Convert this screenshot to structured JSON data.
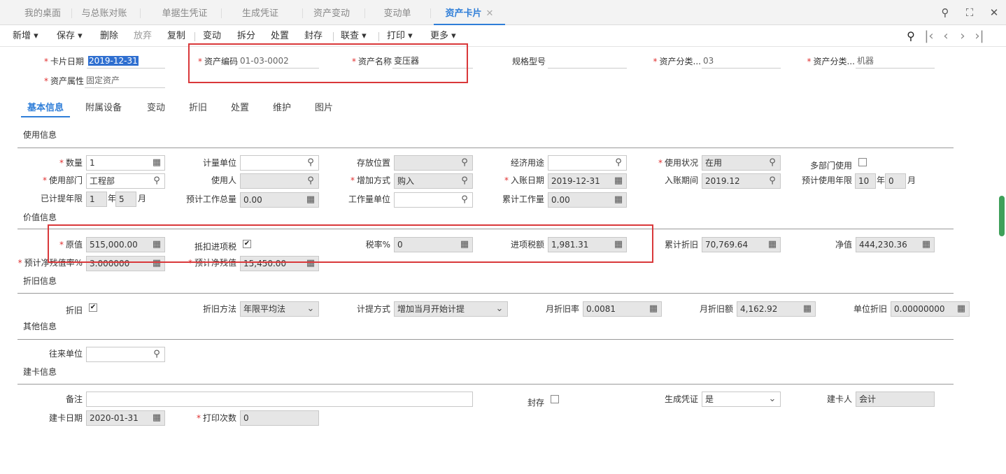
{
  "tabs": [
    "我的桌面",
    "与总账对账",
    "单据生凭证",
    "生成凭证",
    "资产变动",
    "变动单",
    "资产卡片"
  ],
  "tab_close": "✕",
  "toolbar": {
    "new": "新增",
    "save": "保存",
    "delete": "删除",
    "discard": "放弃",
    "copy": "复制",
    "change": "变动",
    "split": "拆分",
    "dispose": "处置",
    "seal": "封存",
    "link": "联查",
    "print": "打印",
    "more": "更多"
  },
  "header": {
    "card_date_label": "卡片日期",
    "card_date": "2019-12-31",
    "asset_code_label": "资产编码",
    "asset_code": "01-03-0002",
    "asset_name_label": "资产名称",
    "asset_name": "变压器",
    "spec_label": "规格型号",
    "spec": "",
    "category1_label": "资产分类...",
    "category1": "03",
    "category2_label": "资产分类...",
    "category2": "机器",
    "attr_label": "资产属性",
    "attr": "固定资产"
  },
  "subtabs": [
    "基本信息",
    "附属设备",
    "变动",
    "折旧",
    "处置",
    "维护",
    "图片"
  ],
  "sections": {
    "usage": "使用信息",
    "value": "价值信息",
    "depr": "折旧信息",
    "other": "其他信息",
    "create": "建卡信息"
  },
  "usage": {
    "qty_label": "数量",
    "qty": "1",
    "unit_label": "计量单位",
    "unit": "",
    "location_label": "存放位置",
    "location": "",
    "econ_label": "经济用途",
    "econ": "",
    "status_label": "使用状况",
    "status": "在用",
    "multi_dept_label": "多部门使用",
    "dept_label": "使用部门",
    "dept": "工程部",
    "user_label": "使用人",
    "user": "",
    "add_method_label": "增加方式",
    "add_method": "购入",
    "entry_date_label": "入账日期",
    "entry_date": "2019-12-31",
    "entry_period_label": "入账期间",
    "entry_period": "2019.12",
    "life_label": "预计使用年限",
    "life_years": "10",
    "life_months": "0",
    "year_unit": "年",
    "month_unit": "月",
    "accrued_label": "已计提年限",
    "accrued_years": "1",
    "accrued_months": "5",
    "total_work_label": "预计工作总量",
    "total_work": "0.00",
    "work_unit_label": "工作量单位",
    "work_unit": "",
    "accum_work_label": "累计工作量",
    "accum_work": "0.00"
  },
  "value": {
    "orig_label": "原值",
    "orig": "515,000.00",
    "deduct_label": "抵扣进项税",
    "tax_rate_label": "税率%",
    "tax_rate": "0",
    "input_tax_label": "进项税额",
    "input_tax": "1,981.31",
    "accum_depr_label": "累计折旧",
    "accum_depr": "70,769.64",
    "net_label": "净值",
    "net": "444,230.36",
    "residual_rate_label": "预计净残值率%",
    "residual_rate": "3.000000",
    "residual_label": "预计净残值",
    "residual": "15,450.00"
  },
  "depr": {
    "depr_label": "折旧",
    "method_label": "折旧方法",
    "method": "年限平均法",
    "accrual_label": "计提方式",
    "accrual": "增加当月开始计提",
    "monthly_rate_label": "月折旧率",
    "monthly_rate": "0.0081",
    "monthly_amt_label": "月折旧额",
    "monthly_amt": "4,162.92",
    "unit_depr_label": "单位折旧",
    "unit_depr": "0.00000000"
  },
  "other": {
    "partner_label": "往来单位",
    "partner": ""
  },
  "create": {
    "remark_label": "备注",
    "remark": "",
    "sealed_label": "封存",
    "gen_voucher_label": "生成凭证",
    "gen_voucher": "是",
    "creator_label": "建卡人",
    "creator": "会计",
    "create_date_label": "建卡日期",
    "create_date": "2020-01-31",
    "print_count_label": "打印次数",
    "print_count": "0"
  },
  "icons": {
    "search": "search-icon",
    "calendar": "calendar-icon",
    "calculator": "calculator-icon",
    "dropdown": "chevron-down-icon"
  }
}
